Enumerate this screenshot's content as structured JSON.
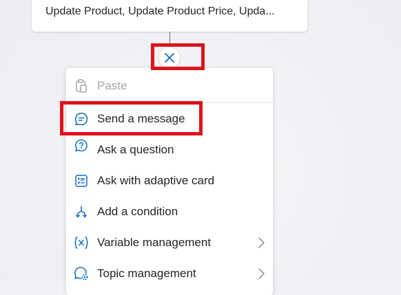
{
  "node_card": {
    "text": "Update Product, Update Product Price, Upda..."
  },
  "menu": {
    "items": [
      {
        "label": "Paste",
        "icon": "paste-icon",
        "disabled": true,
        "submenu": false
      },
      {
        "label": "Send a message",
        "icon": "chat-bubble-icon",
        "disabled": false,
        "submenu": false
      },
      {
        "label": "Ask a question",
        "icon": "question-bubble-icon",
        "disabled": false,
        "submenu": false
      },
      {
        "label": "Ask with adaptive card",
        "icon": "adaptive-card-icon",
        "disabled": false,
        "submenu": false
      },
      {
        "label": "Add a condition",
        "icon": "branch-icon",
        "disabled": false,
        "submenu": false
      },
      {
        "label": "Variable management",
        "icon": "variable-icon",
        "disabled": false,
        "submenu": true
      },
      {
        "label": "Topic management",
        "icon": "topic-gear-icon",
        "disabled": false,
        "submenu": true
      }
    ]
  },
  "colors": {
    "accent": "#0f6cbd",
    "highlight": "#e0121a",
    "disabled_text": "#a6a6a6",
    "text": "#242424"
  }
}
